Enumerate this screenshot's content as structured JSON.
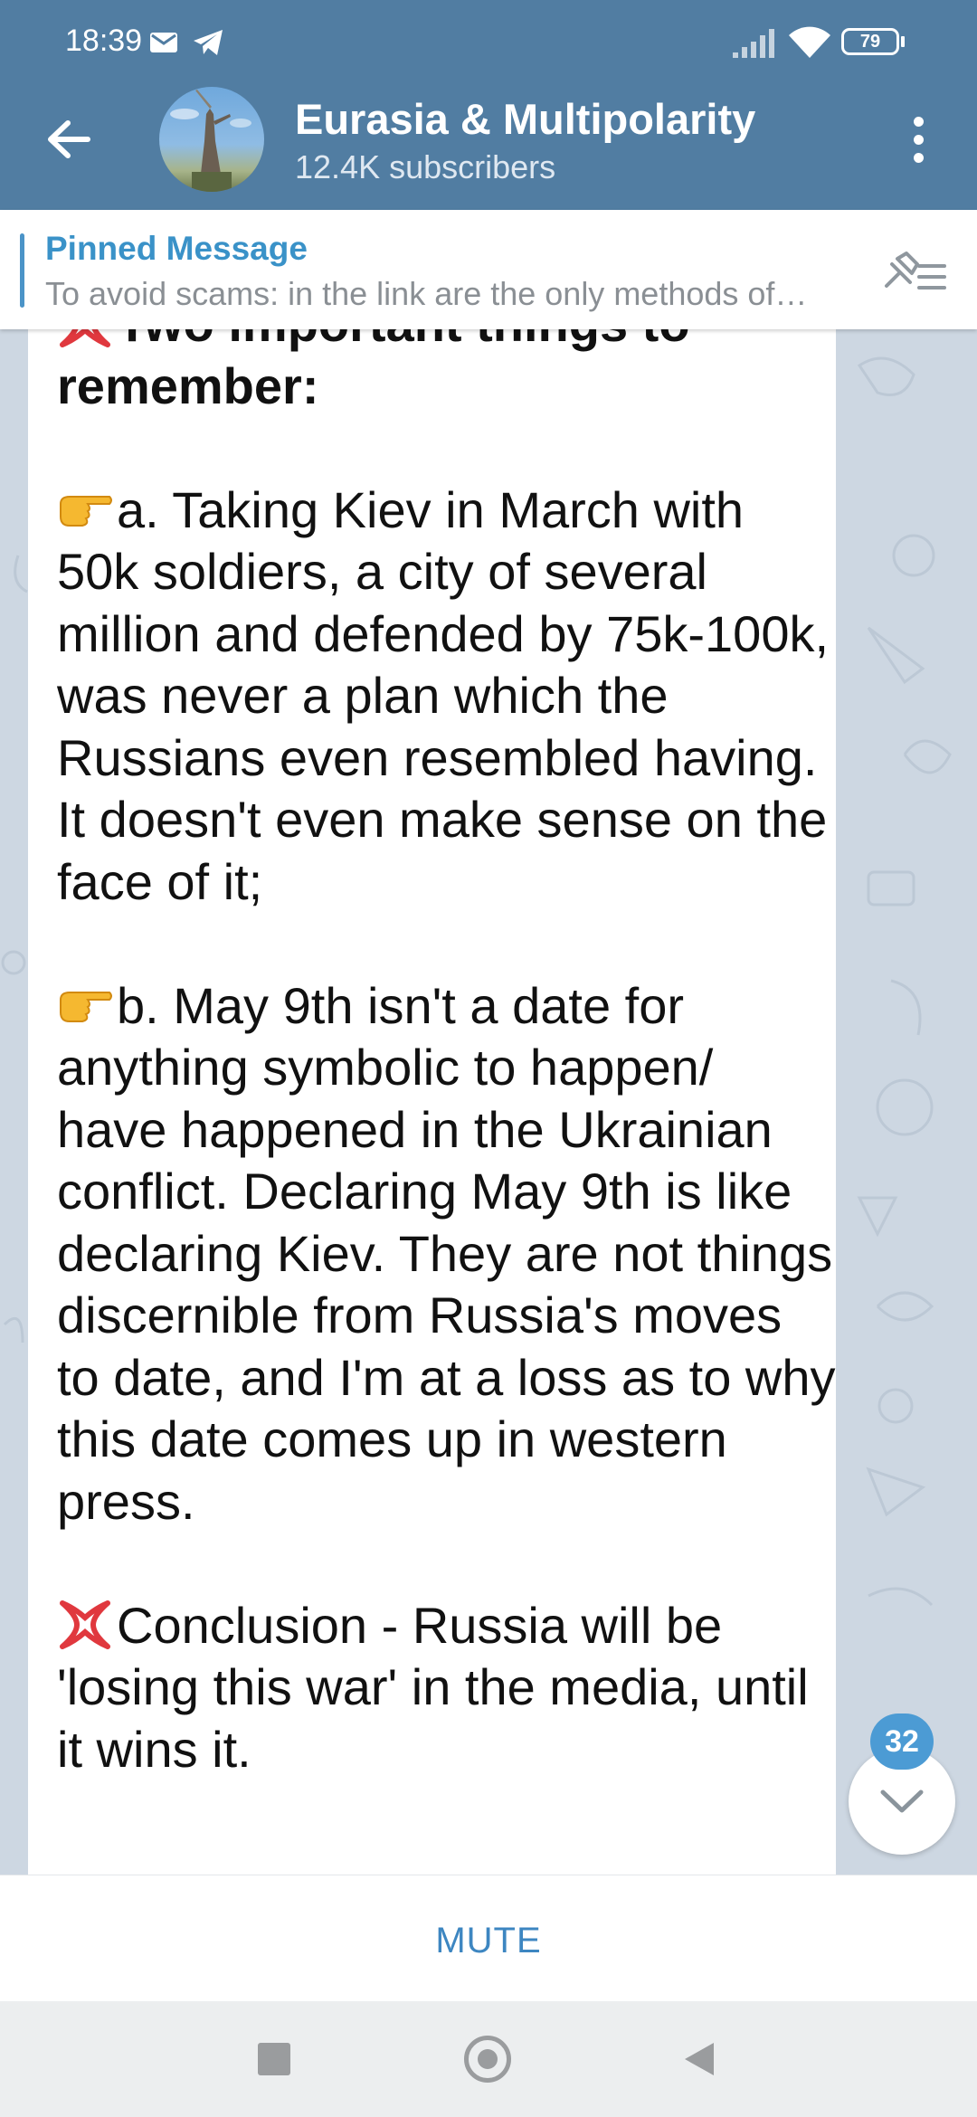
{
  "status_bar": {
    "time": "18:39",
    "battery": "79",
    "icons": [
      "mail-icon",
      "telegram-icon",
      "signal-icon",
      "wifi-icon",
      "battery-icon"
    ]
  },
  "header": {
    "title": "Eurasia & Multipolarity",
    "subtitle": "12.4K subscribers",
    "background_color": "#517da2",
    "icons": [
      "back-arrow-icon",
      "channel-avatar",
      "more-vertical-icon"
    ]
  },
  "pinned": {
    "title": "Pinned Message",
    "text": "To avoid scams: in the link are the only methods of…",
    "icon": "pinned-list-icon"
  },
  "message": {
    "heading": "Two important things to remember:",
    "point_a": "a. Taking Kiev in March with 50k soldiers, a city of several million and defended by 75k-100k, was never a plan which the Russians even resembled having. It doesn't even make sense on the face of it;",
    "point_b": "b. May 9th isn't a date for anything symbolic to happen/ have happened in the Ukrainian conflict. Declaring May 9th is like declaring Kiev. They are not things discernible from Russia's moves to date, and I'm at a loss as to why this date comes up in western press.",
    "conclusion": "Conclusion - Russia will be 'losing this war' in the media, until it wins it.",
    "emojis": [
      "anger-symbol-icon",
      "pointing-hand-icon"
    ]
  },
  "scroll": {
    "unread_count": "32",
    "accent_color": "#4c9bd4"
  },
  "bottom": {
    "mute_label": "MUTE"
  },
  "nav": {
    "icons": [
      "recents-square-icon",
      "home-circle-icon",
      "back-triangle-icon"
    ]
  }
}
